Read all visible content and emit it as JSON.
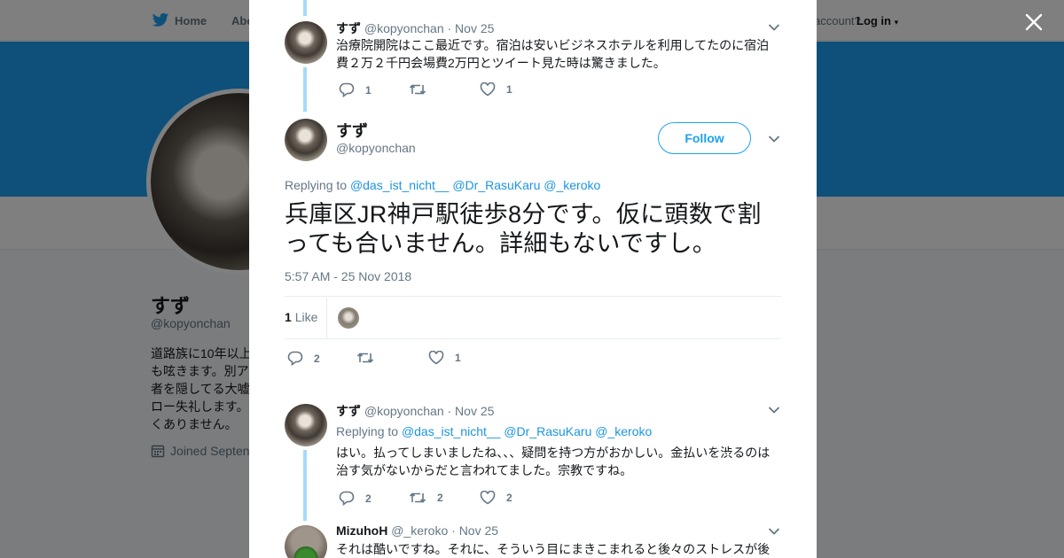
{
  "nav": {
    "home": "Home",
    "about": "Abo",
    "account": "account?",
    "login": "Log in"
  },
  "profile": {
    "name": "すず",
    "handle": "@kopyonchan",
    "bio_lines": [
      "道路族に10年以上",
      "も呟きます。別ア",
      "者を隠してる大嘘",
      "ロー失礼します。",
      "くありません。"
    ],
    "joined": "Joined Septen"
  },
  "tweets": {
    "t1": {
      "name": "すず",
      "handle": "@kopyonchan",
      "date": "· Nov 25",
      "text": "治療院開院はここ最近です。宿泊は安いビジネスホテルを利用してたのに宿泊費２万２千円会場費2万円とツイート見た時は驚きました。",
      "replies": "1",
      "retweets": "",
      "likes": "1"
    },
    "main": {
      "name": "すず",
      "handle": "@kopyonchan",
      "follow": "Follow",
      "replying_label": "Replying to",
      "replying_to": [
        "@das_ist_nicht__",
        "@Dr_RasuKaru",
        "@_keroko"
      ],
      "text": "兵庫区JR神戸駅徒歩8分です。仮に頭数で割っても合いません。詳細もないですし。",
      "time": "5:57 AM - 25 Nov 2018",
      "like_count": "1",
      "like_label": "Like",
      "replies": "2",
      "retweets": "",
      "likes": "1"
    },
    "t3": {
      "name": "すず",
      "handle": "@kopyonchan",
      "date": "· Nov 25",
      "replying_label": "Replying to",
      "replying_to": [
        "@das_ist_nicht__",
        "@Dr_RasuKaru",
        "@_keroko"
      ],
      "text": "はい。払ってしまいましたね、、、疑問を持つ方がおかしい。金払いを渋るのは治す気がないからだと言われてました。宗教ですね。",
      "replies": "2",
      "retweets": "2",
      "likes": "2"
    },
    "t4": {
      "name": "MizuhoH",
      "handle": "@_keroko",
      "date": "· Nov 25",
      "text": "それは酷いですね。それに、そういう目にまきこまれると後々のストレスが後"
    }
  },
  "colors": {
    "accent": "#1da1f2",
    "link": "#1b95e0",
    "thread": "#a5dbf6",
    "muted": "#657786"
  },
  "icons": [
    "twitter-bird-icon",
    "close-icon",
    "chevron-down-icon",
    "reply-icon",
    "retweet-icon",
    "heart-icon",
    "calendar-icon"
  ]
}
